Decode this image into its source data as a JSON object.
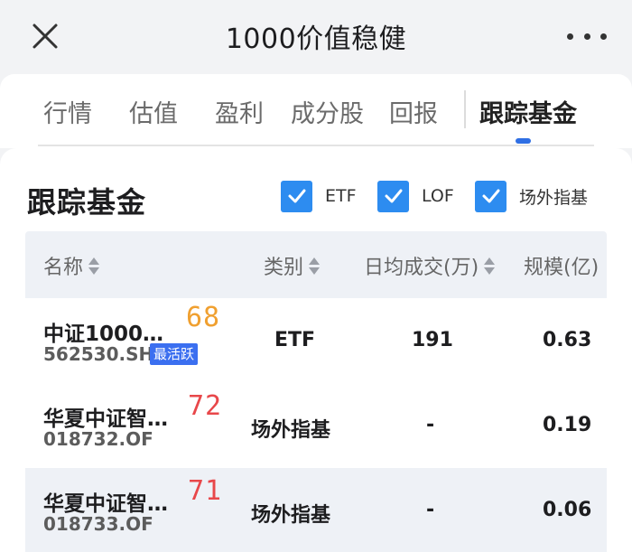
{
  "header": {
    "title": "1000价值稳健"
  },
  "tabs": [
    {
      "label": "行情",
      "active": false
    },
    {
      "label": "估值",
      "active": false
    },
    {
      "label": "盈利",
      "active": false
    },
    {
      "label": "成分股",
      "active": false
    },
    {
      "label": "回报",
      "active": false
    },
    {
      "label": "跟踪基金",
      "active": true
    }
  ],
  "section": {
    "title": "跟踪基金",
    "filters": [
      {
        "label": "ETF",
        "checked": true
      },
      {
        "label": "LOF",
        "checked": true
      },
      {
        "label": "场外指基",
        "checked": true
      }
    ]
  },
  "table": {
    "columns": [
      "名称",
      "类别",
      "日均成交(万)",
      "规模(亿)"
    ],
    "rows": [
      {
        "name": "中证1000…",
        "code": "562530.SH",
        "badge": "最活跃",
        "score": "68",
        "score_color": "#f0a030",
        "category": "ETF",
        "volume": "191",
        "scale": "0.63"
      },
      {
        "name": "华夏中证智…",
        "code": "018732.OF",
        "badge": "",
        "score": "72",
        "score_color": "#e8474a",
        "category": "场外指基",
        "volume": "-",
        "scale": "0.19"
      },
      {
        "name": "华夏中证智…",
        "code": "018733.OF",
        "badge": "",
        "score": "71",
        "score_color": "#e8474a",
        "category": "场外指基",
        "volume": "-",
        "scale": "0.06"
      }
    ]
  },
  "colors": {
    "accent": "#2f6fe4",
    "checkbox": "#2d8cf0",
    "badge": "#3b6ff0",
    "score_orange": "#f0a030",
    "score_red": "#e8474a"
  }
}
